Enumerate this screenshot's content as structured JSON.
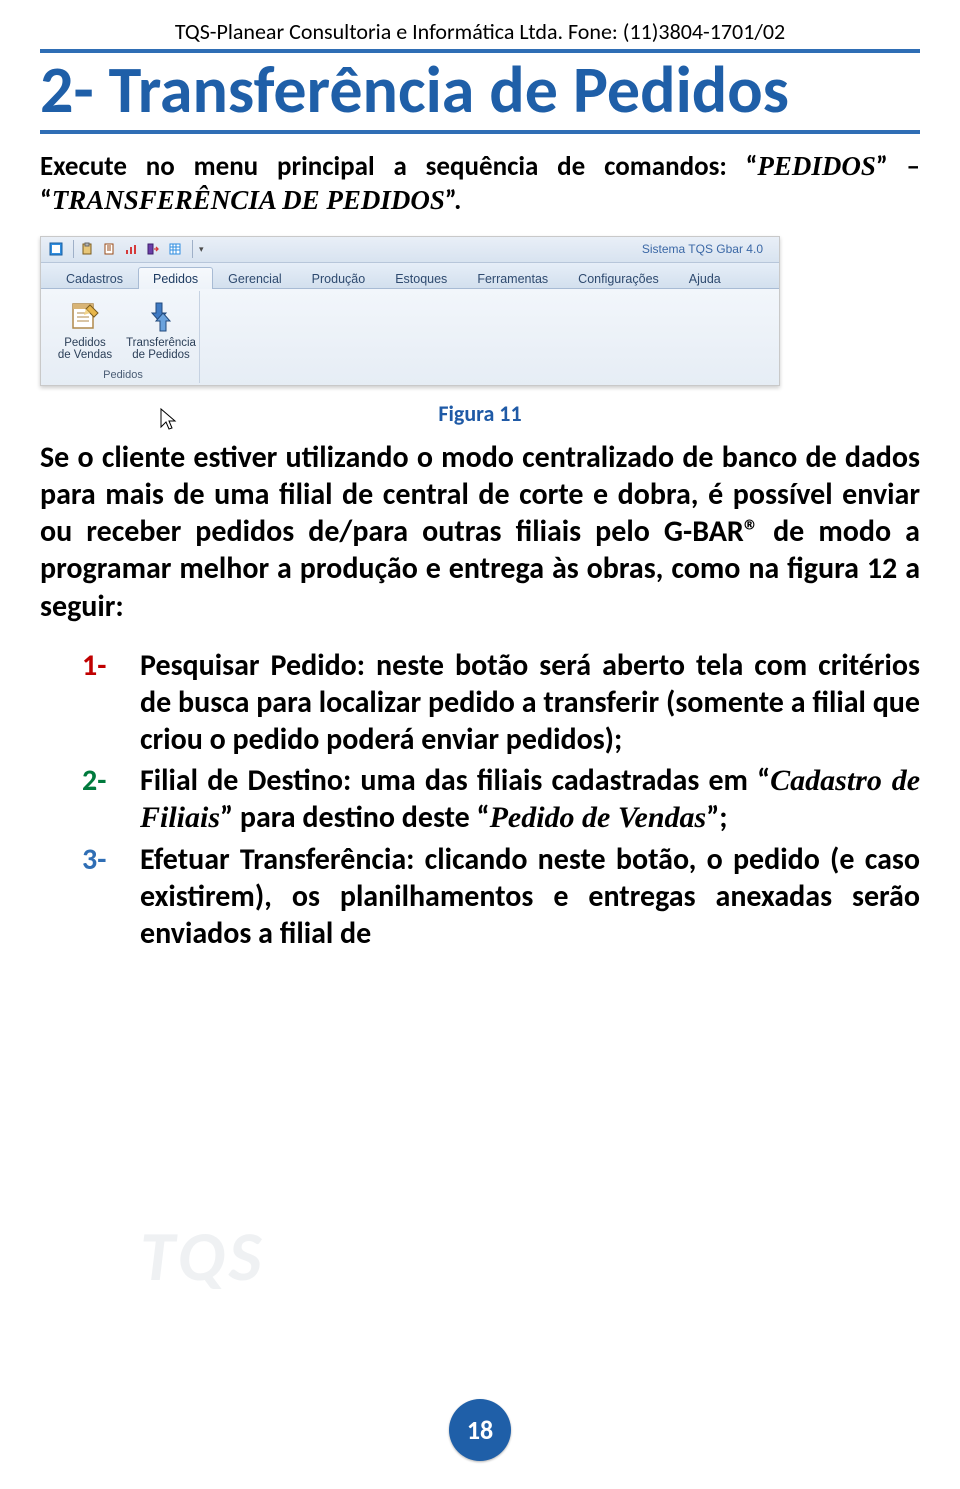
{
  "header": "TQS-Planear Consultoria e Informática Ltda. Fone: (11)3804-1701/02",
  "title": "2- Transferência de Pedidos",
  "lede": {
    "pre": "Execute no menu principal a sequência de comandos: “",
    "cmd1": "PEDIDOS",
    "mid": "” – “",
    "cmd2": "TRANSFERÊNCIA DE PEDIDOS",
    "post": "”."
  },
  "ribbon": {
    "system_title": "Sistema TQS Gbar 4.0",
    "qat_icons": [
      "app-icon",
      "clipboard-icon",
      "notebook-icon",
      "barchart-icon",
      "exit-icon",
      "grid-icon"
    ],
    "tabs": [
      "Cadastros",
      "Pedidos",
      "Gerencial",
      "Produção",
      "Estoques",
      "Ferramentas",
      "Configurações",
      "Ajuda"
    ],
    "active_tab_index": 1,
    "group_label": "Pedidos",
    "buttons": [
      {
        "name": "pedidos-vendas-button",
        "icon": "notepad-pencil-icon",
        "label_l1": "Pedidos",
        "label_l2": "de Vendas"
      },
      {
        "name": "transferencia-pedidos-button",
        "icon": "arrows-exchange-icon",
        "label_l1": "Transferência",
        "label_l2": "de Pedidos"
      }
    ]
  },
  "figure_caption": "Figura 11",
  "body_para": "Se o cliente estiver utilizando o modo centralizado de banco de dados para mais de uma filial de central de corte e dobra, é possível enviar ou receber pedidos de/para outras filiais pelo G-BAR® de modo a programar melhor a produção e entrega às obras, como na figura 12 a seguir:",
  "steps": [
    {
      "num": "1-",
      "num_color": "red",
      "lead": "Pesquisar Pedido:",
      "rest": " neste botão será aberto tela com critérios de busca para localizar pedido a transferir (somente a filial que criou o pedido poderá enviar pedidos);"
    },
    {
      "num": "2-",
      "num_color": "green",
      "lead": "Filial de Destino:",
      "rest_a": " uma das filiais cadastradas em “",
      "ital_a": "Cadastro de Filiais",
      "rest_b": "” para destino deste “",
      "ital_b": "Pedido de Vendas",
      "rest_c": "”;"
    },
    {
      "num": "3-",
      "num_color": "blue",
      "lead": "Efetuar Transferência:",
      "rest": " clicando neste botão, o pedido (e caso existirem), os planilhamentos e entregas anexadas serão enviados a filial de"
    }
  ],
  "page_number": "18",
  "watermark": "TQS"
}
